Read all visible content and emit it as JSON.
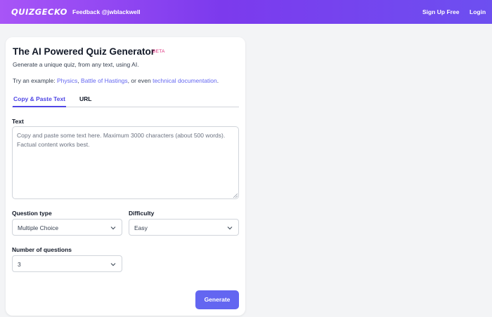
{
  "header": {
    "logo": "QUIZGECKO",
    "feedback": "Feedback @jwblackwell",
    "signup": "Sign Up Free",
    "login": "Login"
  },
  "form": {
    "title": "The AI Powered Quiz Generator",
    "beta": "BETA",
    "subtitle": "Generate a unique quiz, from any text, using AI.",
    "example_prefix": "Try an example: ",
    "example_links": [
      "Physics",
      "Battle of Hastings",
      "technical documentation"
    ],
    "example_sep1": ", ",
    "example_sep2": ", or even ",
    "example_suffix": ".",
    "tabs": [
      "Copy & Paste Text",
      "URL"
    ],
    "text_label": "Text",
    "text_placeholder": "Copy and paste some text here. Maximum 3000 characters (about 500 words). Factual content works best.",
    "question_type_label": "Question type",
    "question_type_value": "Multiple Choice",
    "difficulty_label": "Difficulty",
    "difficulty_value": "Easy",
    "num_questions_label": "Number of questions",
    "num_questions_value": "3",
    "generate_label": "Generate"
  },
  "colors": {
    "accent": "#6366f1",
    "header_gradient_start": "#a855f7",
    "header_gradient_end": "#6d4ff0",
    "beta": "#db2777"
  }
}
